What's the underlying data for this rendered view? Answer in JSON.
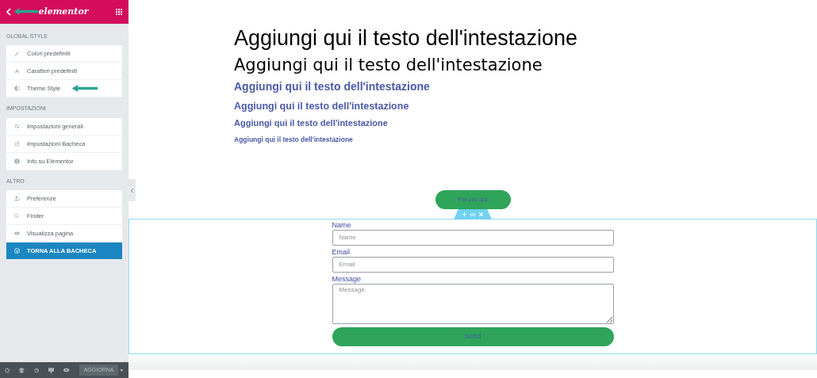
{
  "header": {
    "logo": "elementor"
  },
  "menu_groups": [
    {
      "title": "GLOBAL STYLE",
      "items": [
        {
          "label": "Colori predefiniti",
          "selected": false
        },
        {
          "label": "Caratteri predefiniti",
          "selected": false
        },
        {
          "label": "Theme Style",
          "selected": false
        }
      ]
    },
    {
      "title": "IMPOSTAZIONI",
      "items": [
        {
          "label": "Impostazioni generali",
          "selected": false
        },
        {
          "label": "Impostazioni Bacheca",
          "selected": false
        },
        {
          "label": "Info su Elementor",
          "selected": false
        }
      ]
    },
    {
      "title": "ALTRO",
      "items": [
        {
          "label": "Preferenze",
          "selected": false
        },
        {
          "label": "Finder",
          "selected": false
        },
        {
          "label": "Visualizza pagina",
          "selected": false
        },
        {
          "label": "TORNA ALLA BACHECA",
          "selected": true
        }
      ]
    }
  ],
  "footer": {
    "update_button": "AGGIORNA"
  },
  "headings": [
    "Aggiungi qui il testo dell'intestazione",
    "Aggiungi qui il testo dell'intestazione",
    "Aggiungi qui il testo dell'intestazione",
    "Aggiungi qui il testo dell'intestazione",
    "Aggiungi qui il testo dell'intestazione",
    "Aggiungi qui il testo dell'intestazione"
  ],
  "cta_button": {
    "label": "Fai clic qui"
  },
  "form": {
    "fields": [
      {
        "label": "Name",
        "placeholder": "Name",
        "kind": "input"
      },
      {
        "label": "Email",
        "placeholder": "Email",
        "kind": "input"
      },
      {
        "label": "Message",
        "placeholder": "Message",
        "kind": "textarea"
      }
    ],
    "submit": "Send"
  }
}
